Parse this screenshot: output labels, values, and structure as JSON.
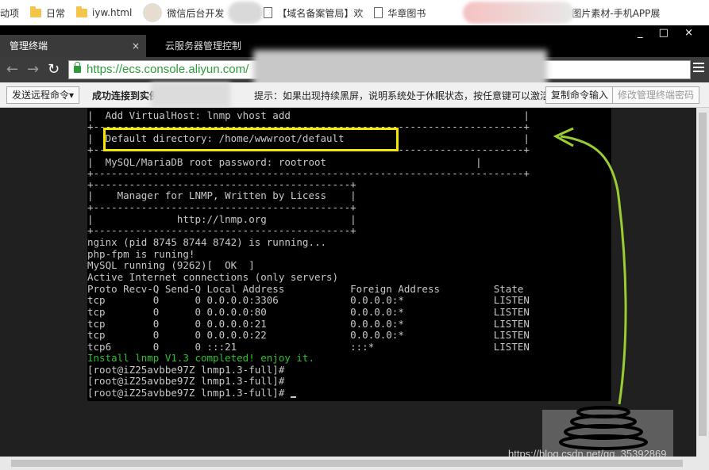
{
  "bookmarks": [
    {
      "label": "动项",
      "icon": "none"
    },
    {
      "label": "日常",
      "icon": "folder-icon"
    },
    {
      "label": "iyw.html",
      "icon": "folder-icon"
    },
    {
      "label": "微信后台开发",
      "icon": "avatar-icon"
    },
    {
      "label": "【域名备案管局】欢",
      "icon": "page-icon"
    },
    {
      "label": "华章图书",
      "icon": "page-icon"
    },
    {
      "label": "图片素材-手机APP展",
      "icon": "app-icon"
    }
  ],
  "tabs": [
    {
      "label": "管理终端",
      "active": true,
      "close": "×"
    },
    {
      "label": "云服务器管理控制",
      "active": false
    }
  ],
  "window_controls": "_ □ ×",
  "address": {
    "url": "https://ecs.console.aliyun.com/"
  },
  "toolbar": {
    "send_command": "发送远程命令▾",
    "status": "成功连接到实例",
    "tip": "提示：如果出现持续黑屏，说明系统处于休眠状态，按任意键可以激活。",
    "copy_command": "复制命令输入",
    "change_password": "修改管理终端密码"
  },
  "terminal": {
    "lines": [
      "|  Add VirtualHost: lnmp vhost add                                       |",
      "+------------------------------------------------------------------------+",
      "|  Default directory: /home/wwwroot/default                              |",
      "+------------------------------------------------------------------------+",
      "|  MySQL/MariaDB root password: rootroot                         |",
      "+------------------------------------------------------------------------+",
      "+-------------------------------------------+",
      "|    Manager for LNMP, Written by Licess    |",
      "+-------------------------------------------+",
      "|              http://lnmp.org              |",
      "+-------------------------------------------+",
      "nginx (pid 8745 8744 8742) is running...",
      "php-fpm is runing!",
      "MySQL running (9262)[  OK  ]",
      "Active Internet connections (only servers)",
      "Proto Recv-Q Send-Q Local Address           Foreign Address         State",
      "tcp        0      0 0.0.0.0:3306            0.0.0.0:*               LISTEN",
      "tcp        0      0 0.0.0.0:80              0.0.0.0:*               LISTEN",
      "tcp        0      0 0.0.0.0:21              0.0.0.0:*               LISTEN",
      "tcp        0      0 0.0.0.0:22              0.0.0.0:*               LISTEN",
      "tcp6       0      0 :::21                   :::*                    LISTEN",
      "Install lnmp V1.3 completed! enjoy it.",
      "[root@iZ25avbbe97Z lnmp1.3-full]#",
      "[root@iZ25avbbe97Z lnmp1.3-full]#",
      "[root@iZ25avbbe97Z lnmp1.3-full]# "
    ],
    "green_line_index": 21
  },
  "watermark": "https://blog.csdn.net/qq_35392869",
  "colors": {
    "terminal_text": "#c8c8c8",
    "success_text": "#2fbf2f",
    "highlight": "#f4e800",
    "annotation": "#9acd32"
  }
}
